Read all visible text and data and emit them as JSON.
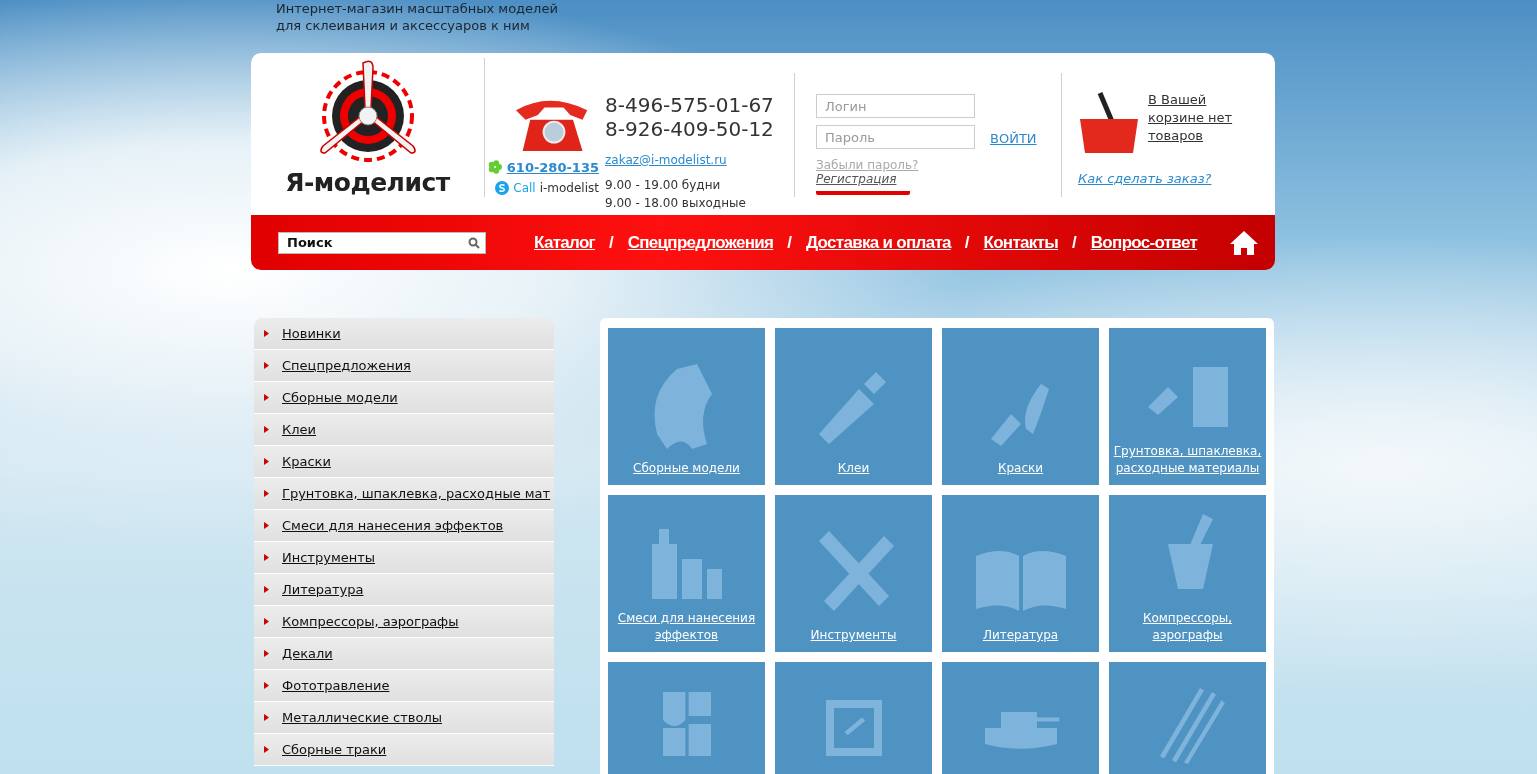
{
  "tagline": [
    "Интернет-магазин масштабных моделей",
    "для склеивания и аксессуаров к ним"
  ],
  "logo": {
    "name": "Я-моделист"
  },
  "contacts": {
    "phones": [
      "8-496-575-01-67",
      "8-926-409-50-12"
    ],
    "icq": "610-280-135",
    "skype_label": "Call",
    "skype_name": "i-modelist",
    "email": "zakaz@i-modelist.ru",
    "hours": [
      "9.00 - 19.00 будни",
      "9.00 - 18.00 выходные"
    ]
  },
  "login": {
    "login_placeholder": "Логин",
    "password_placeholder": "Пароль",
    "submit": "ВОЙТИ",
    "forgot": "Забыли пароль?",
    "register": "Регистрация",
    "register_highlighted": true
  },
  "cart": {
    "status": "В Вашей корзине нет товаров",
    "how_to_order": "Как сделать заказ?"
  },
  "search": {
    "placeholder": "Поиск"
  },
  "nav": [
    {
      "label": "Каталог"
    },
    {
      "label": "Спецпредложения"
    },
    {
      "label": "Доставка и оплата"
    },
    {
      "label": "Контакты"
    },
    {
      "label": "Вопрос-ответ"
    }
  ],
  "nav_separator": "/",
  "sidebar": {
    "items": [
      {
        "label": "Новинки"
      },
      {
        "label": "Спецпредложения"
      },
      {
        "label": "Сборные модели"
      },
      {
        "label": "Клеи"
      },
      {
        "label": "Краски"
      },
      {
        "label": "Грунтовка, шпаклевка, расходные мат"
      },
      {
        "label": "Смеси для нанесения эффектов"
      },
      {
        "label": "Инструменты"
      },
      {
        "label": "Литература"
      },
      {
        "label": "Компрессоры, аэрографы"
      },
      {
        "label": "Декали"
      },
      {
        "label": "Фототравление"
      },
      {
        "label": "Металлические стволы"
      },
      {
        "label": "Сборные траки"
      }
    ]
  },
  "categories": [
    {
      "kind": "labeled",
      "label": "Сборные модели"
    },
    {
      "kind": "labeled",
      "label": "Клеи"
    },
    {
      "kind": "labeled",
      "label": "Краски"
    },
    {
      "kind": "labeled",
      "label": "Грунтовка, шпаклевка, расходные материалы"
    },
    {
      "kind": "labeled",
      "label": "Смеси для нанесения эффектов"
    },
    {
      "kind": "labeled",
      "label": "Инструменты"
    },
    {
      "kind": "labeled",
      "label": "Литература"
    },
    {
      "kind": "labeled",
      "label": "Компрессоры, аэрографы"
    },
    {
      "kind": "icon"
    },
    {
      "kind": "icon"
    },
    {
      "kind": "icon"
    },
    {
      "kind": "icon"
    }
  ]
}
